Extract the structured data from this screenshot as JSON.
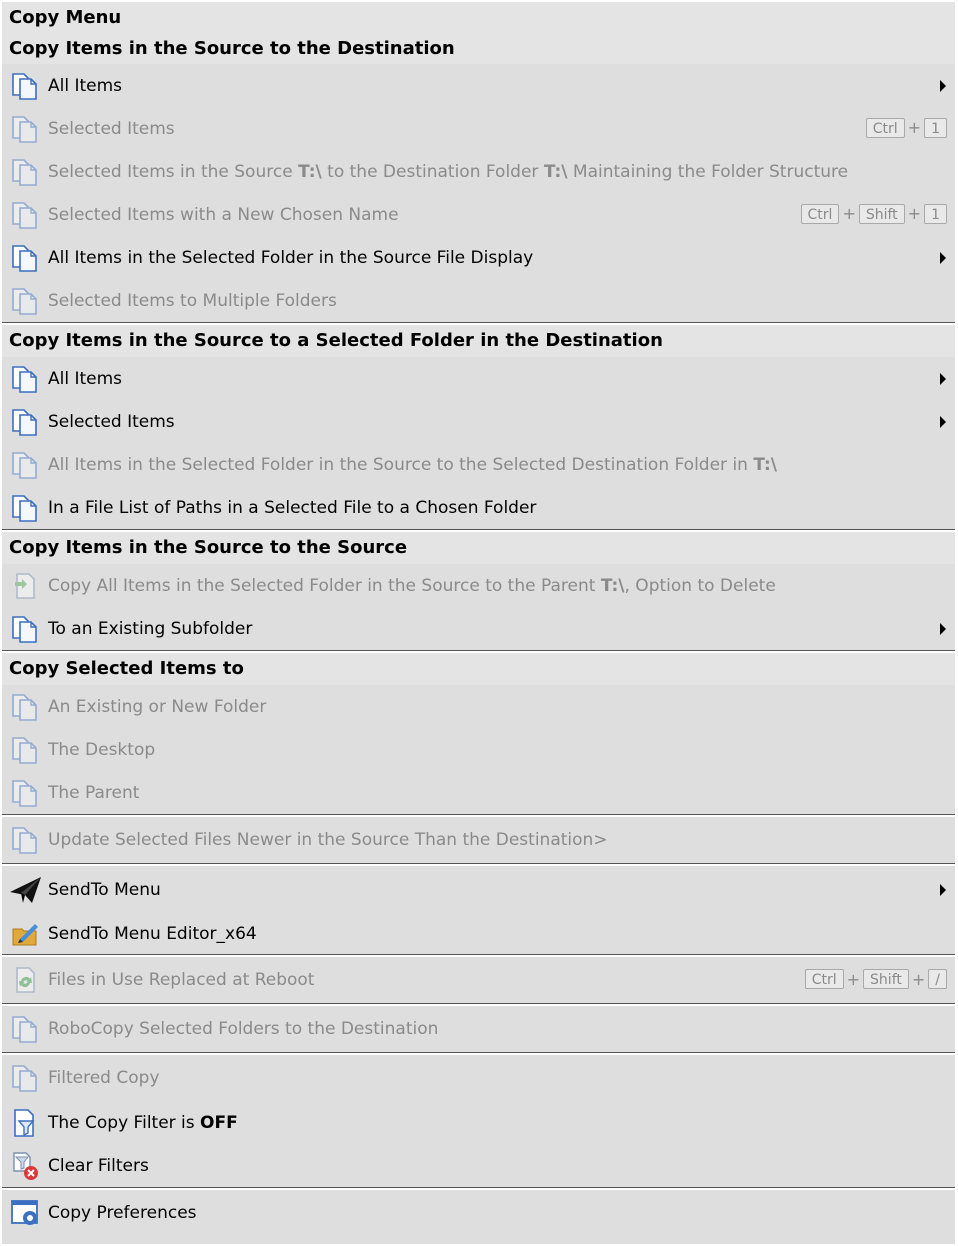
{
  "menu": {
    "title": "Copy Menu",
    "sections": [
      {
        "header": "Copy Items in the Source to the Destination",
        "items": [
          {
            "label": "All Items",
            "icon": "copy-icon",
            "disabled": false,
            "submenu": true
          },
          {
            "label": "Selected Items",
            "icon": "copy-icon",
            "disabled": true,
            "shortcut": [
              "Ctrl",
              "1"
            ]
          },
          {
            "label_parts": [
              "Selected Items in the Source ",
              "T:\\",
              " to the Destination Folder ",
              "T:\\",
              " Maintaining the Folder Structure"
            ],
            "icon": "copy-icon",
            "disabled": true
          },
          {
            "label": "Selected Items with a New Chosen Name",
            "icon": "copy-icon",
            "disabled": true,
            "shortcut": [
              "Ctrl",
              "Shift",
              "1"
            ]
          },
          {
            "label": "All Items in the Selected Folder in the Source File Display",
            "icon": "copy-icon",
            "disabled": false,
            "submenu": true
          },
          {
            "label": "Selected Items to Multiple Folders",
            "icon": "copy-icon",
            "disabled": true
          }
        ]
      },
      {
        "header": "Copy Items in the Source to a Selected Folder in the Destination",
        "items": [
          {
            "label": "All Items",
            "icon": "copy-icon",
            "disabled": false,
            "submenu": true
          },
          {
            "label": "Selected Items",
            "icon": "copy-icon",
            "disabled": false,
            "submenu": true
          },
          {
            "label_parts": [
              "All Items in the Selected Folder in the Source  to the Selected Destination Folder in ",
              "T:\\"
            ],
            "icon": "copy-icon",
            "disabled": true
          },
          {
            "label": "In a File List of Paths in a Selected File to a Chosen Folder",
            "icon": "copy-icon",
            "disabled": false
          }
        ]
      },
      {
        "header": "Copy Items in the Source to the Source",
        "items": [
          {
            "label_parts": [
              "Copy All Items in the Selected Folder in the Source  to the Parent ",
              "T:\\",
              ", Option to Delete"
            ],
            "icon": "copy-to-parent-icon",
            "disabled": true
          },
          {
            "label": "To an Existing Subfolder",
            "icon": "copy-icon",
            "disabled": false,
            "submenu": true
          }
        ]
      },
      {
        "header": "Copy Selected Items to",
        "items": [
          {
            "label": "An Existing or New Folder",
            "icon": "copy-icon",
            "disabled": true
          },
          {
            "label": "The Desktop",
            "icon": "copy-icon",
            "disabled": true
          },
          {
            "label": "The Parent",
            "icon": "copy-icon",
            "disabled": true
          }
        ]
      }
    ],
    "update_item": {
      "label": "Update Selected Files Newer in the Source Than the Destination>",
      "disabled": true
    },
    "sendto": {
      "label": "SendTo Menu",
      "editor_label": "SendTo Menu Editor_x64"
    },
    "files_in_use": {
      "label": "Files in Use Replaced at Reboot",
      "shortcut": [
        "Ctrl",
        "Shift",
        "/"
      ]
    },
    "robocopy": {
      "label": "RoboCopy Selected Folders to the Destination"
    },
    "filtered_copy": {
      "label": "Filtered Copy"
    },
    "copy_filter": {
      "label_prefix": "The Copy Filter is ",
      "state": "OFF"
    },
    "clear_filters": {
      "label": "Clear Filters"
    },
    "preferences": {
      "label": "Copy Preferences"
    }
  },
  "plus_sign": "+"
}
